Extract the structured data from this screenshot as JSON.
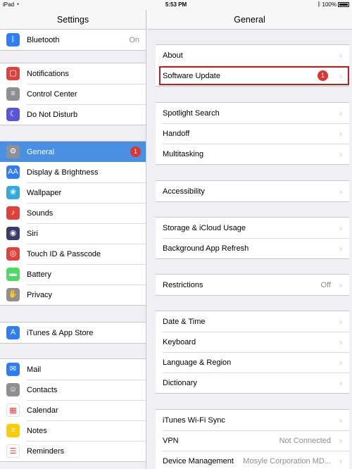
{
  "status": {
    "device": "iPad",
    "time": "5:53 PM",
    "battery": "100%"
  },
  "left": {
    "title": "Settings",
    "groups": [
      [
        {
          "icon": "bluetooth-icon",
          "label": "Bluetooth",
          "value": "On",
          "color": "#2f7df6",
          "glyph": "ᛒ"
        }
      ],
      [
        {
          "icon": "notifications-icon",
          "label": "Notifications",
          "color": "#e2403a",
          "glyph": "▢"
        },
        {
          "icon": "control-center-icon",
          "label": "Control Center",
          "color": "#8e8e93",
          "glyph": "≡"
        },
        {
          "icon": "do-not-disturb-icon",
          "label": "Do Not Disturb",
          "color": "#5856d6",
          "glyph": "☾"
        }
      ],
      [
        {
          "icon": "general-icon",
          "label": "General",
          "badge": "1",
          "selected": true,
          "color": "#8e8e93",
          "glyph": "⚙"
        },
        {
          "icon": "display-brightness-icon",
          "label": "Display & Brightness",
          "color": "#2f7df6",
          "glyph": "AA"
        },
        {
          "icon": "wallpaper-icon",
          "label": "Wallpaper",
          "color": "#34aadc",
          "glyph": "❀"
        },
        {
          "icon": "sounds-icon",
          "label": "Sounds",
          "color": "#e2403a",
          "glyph": "♪"
        },
        {
          "icon": "siri-icon",
          "label": "Siri",
          "color": "#3b3b6b",
          "glyph": "◉"
        },
        {
          "icon": "touch-id-icon",
          "label": "Touch ID & Passcode",
          "color": "#e2403a",
          "glyph": "◎"
        },
        {
          "icon": "battery-icon",
          "label": "Battery",
          "color": "#4cd964",
          "glyph": "▬"
        },
        {
          "icon": "privacy-icon",
          "label": "Privacy",
          "color": "#8e8e93",
          "glyph": "✋"
        }
      ],
      [
        {
          "icon": "app-store-icon",
          "label": "iTunes & App Store",
          "color": "#2f7df6",
          "glyph": "A"
        }
      ],
      [
        {
          "icon": "mail-icon",
          "label": "Mail",
          "color": "#2f7df6",
          "glyph": "✉"
        },
        {
          "icon": "contacts-icon",
          "label": "Contacts",
          "color": "#8e8e93",
          "glyph": "☺"
        },
        {
          "icon": "calendar-icon",
          "label": "Calendar",
          "color": "#ffffff",
          "glyph": "▦"
        },
        {
          "icon": "notes-icon",
          "label": "Notes",
          "color": "#ffcc00",
          "glyph": "≡"
        },
        {
          "icon": "reminders-icon",
          "label": "Reminders",
          "color": "#ffffff",
          "glyph": "☰"
        }
      ]
    ]
  },
  "right": {
    "title": "General",
    "groups": [
      [
        {
          "label": "About"
        },
        {
          "label": "Software Update",
          "badge": "1",
          "highlight": true
        }
      ],
      [
        {
          "label": "Spotlight Search"
        },
        {
          "label": "Handoff"
        },
        {
          "label": "Multitasking"
        }
      ],
      [
        {
          "label": "Accessibility"
        }
      ],
      [
        {
          "label": "Storage & iCloud Usage"
        },
        {
          "label": "Background App Refresh"
        }
      ],
      [
        {
          "label": "Restrictions",
          "value": "Off"
        }
      ],
      [
        {
          "label": "Date & Time"
        },
        {
          "label": "Keyboard"
        },
        {
          "label": "Language & Region"
        },
        {
          "label": "Dictionary"
        }
      ],
      [
        {
          "label": "iTunes Wi-Fi Sync"
        },
        {
          "label": "VPN",
          "value": "Not Connected"
        },
        {
          "label": "Device Management",
          "value": "Mosyle Corporation MD..."
        }
      ]
    ]
  }
}
